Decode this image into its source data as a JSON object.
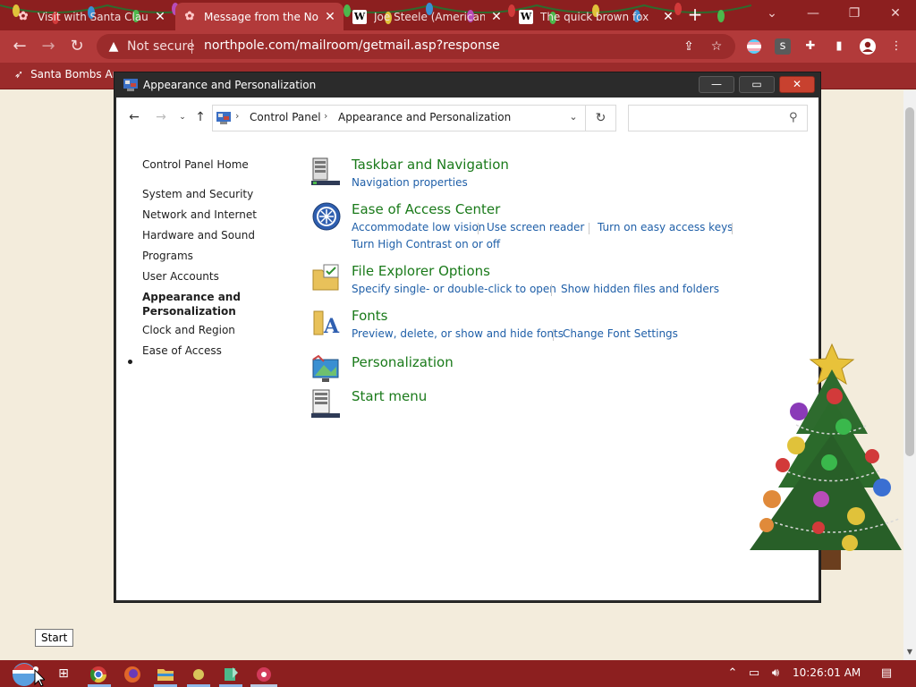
{
  "browser": {
    "tabs": [
      {
        "label": "Visit with Santa Claus",
        "icon": "santa-favicon"
      },
      {
        "label": "Message from the North Pole",
        "icon": "santa-favicon",
        "active": true
      },
      {
        "label": "Joe Steele (American",
        "icon": "wikipedia-favicon",
        "favicon_text": "W"
      },
      {
        "label": "The quick brown fox",
        "icon": "wikipedia-favicon",
        "favicon_text": "W"
      }
    ],
    "new_tab_glyph": "+",
    "window_controls": {
      "minimize": "—",
      "restore": "❐",
      "close": "✕",
      "tab_search": "⌄"
    },
    "toolbar": {
      "not_secure": "Not secure",
      "url": "northpole.com/mailroom/getmail.asp?response",
      "profile_extension": "s"
    },
    "bookmark": {
      "label": "Santa Bombs Ara",
      "icon": "rocket-icon"
    }
  },
  "page": {
    "start_tooltip": "Start"
  },
  "control_panel": {
    "title": "Appearance and Personalization",
    "breadcrumb": [
      "Control Panel",
      "Appearance and Personalization"
    ],
    "search_placeholder": "",
    "left_nav": [
      {
        "label": "Control Panel Home"
      },
      {
        "label": "System and Security"
      },
      {
        "label": "Network and Internet"
      },
      {
        "label": "Hardware and Sound"
      },
      {
        "label": "Programs"
      },
      {
        "label": "User Accounts"
      },
      {
        "label_line1": "Appearance and",
        "label_line2": "Personalization",
        "current": true
      },
      {
        "label": "Clock and Region"
      },
      {
        "label": "Ease of Access"
      }
    ],
    "categories": [
      {
        "title": "Taskbar and Navigation",
        "icon": "taskbar-icon",
        "links": [
          "Navigation properties"
        ]
      },
      {
        "title": "Ease of Access Center",
        "icon": "ease-of-access-icon",
        "links": [
          "Accommodate low vision",
          "Use screen reader",
          "Turn on easy access keys",
          "Turn High Contrast on or off"
        ]
      },
      {
        "title": "File Explorer Options",
        "icon": "folder-options-icon",
        "links": [
          "Specify single- or double-click to open",
          "Show hidden files and folders"
        ]
      },
      {
        "title": "Fonts",
        "icon": "fonts-icon",
        "links": [
          "Preview, delete, or show and hide fonts",
          "Change Font Settings"
        ]
      },
      {
        "title": "Personalization",
        "icon": "personalization-icon",
        "links": []
      },
      {
        "title": "Start menu",
        "icon": "start-menu-icon",
        "links": []
      }
    ]
  },
  "taskbar": {
    "clock": "10:26:01 AM",
    "apps": [
      "task-view-icon",
      "chrome-icon",
      "firefox-icon",
      "file-explorer-icon",
      "app-icon",
      "notepad-icon",
      "santa-app-icon"
    ]
  }
}
